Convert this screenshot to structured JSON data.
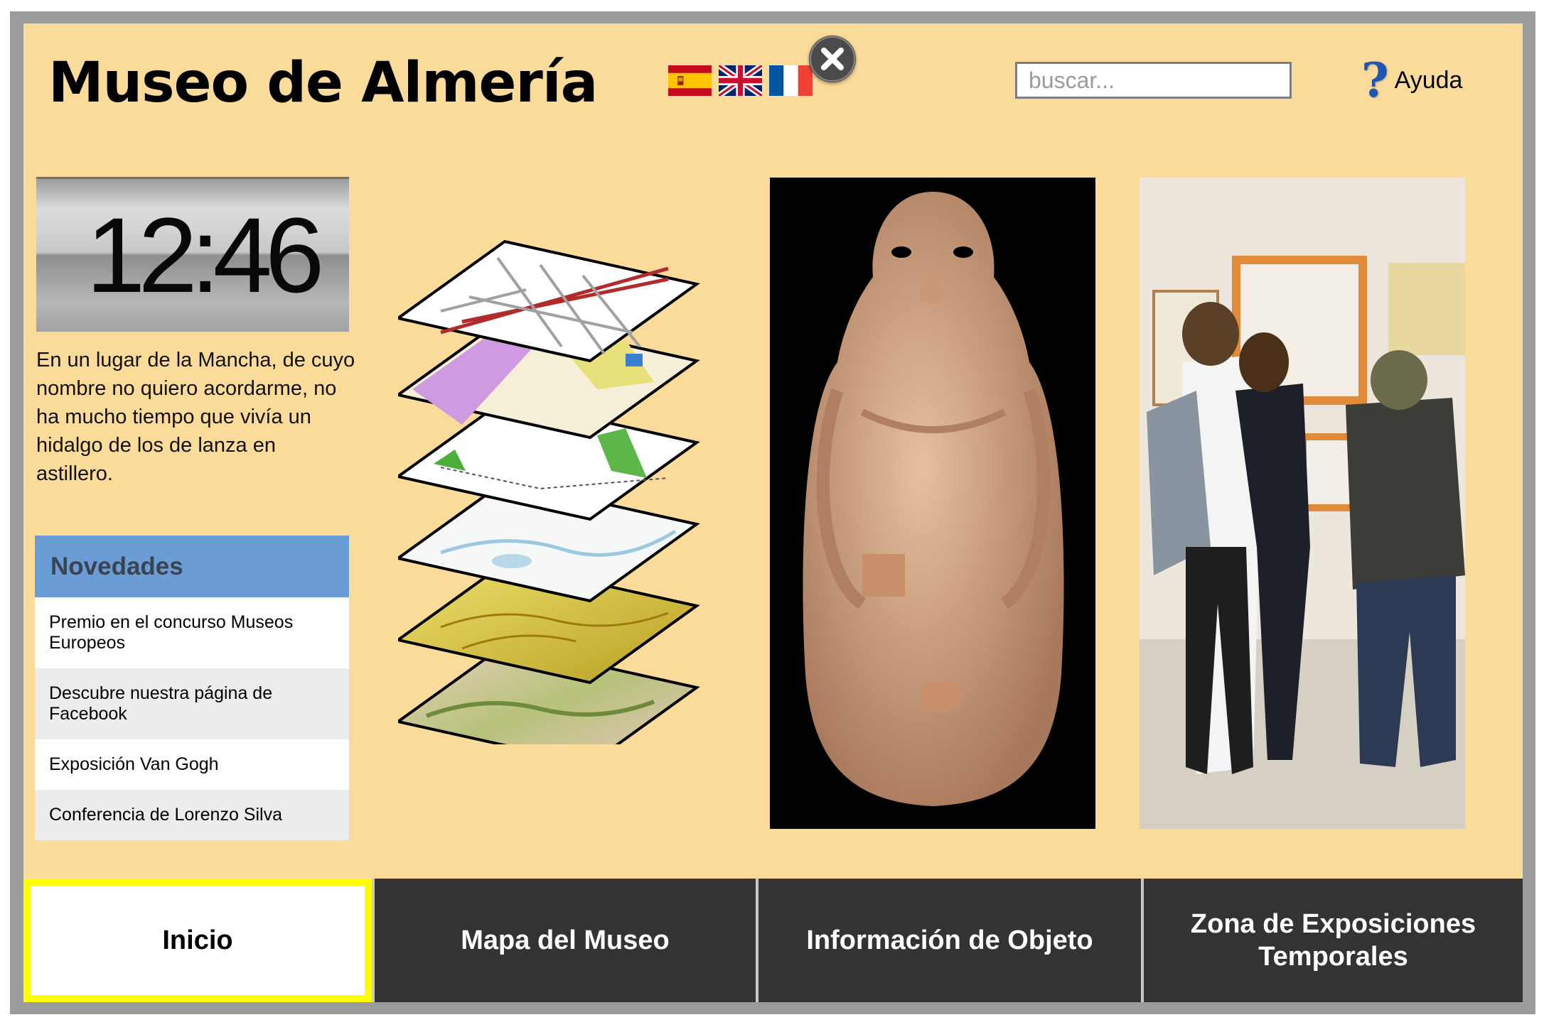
{
  "header": {
    "title": "Museo de Almería",
    "search_placeholder": "buscar...",
    "help_label": "Ayuda"
  },
  "languages": [
    {
      "name": "español",
      "icon": "spain-flag-icon"
    },
    {
      "name": "english",
      "icon": "uk-flag-icon"
    },
    {
      "name": "français",
      "icon": "france-flag-icon"
    }
  ],
  "icons": {
    "close": "close-icon",
    "help": "help-icon"
  },
  "clock": {
    "time": "12:46"
  },
  "intro_text": "En un lugar de la Mancha, de cuyo nombre no quiero acordarme, no ha mucho tiempo que vivía un hidalgo de los de lanza en astillero.",
  "news": {
    "title": "Novedades",
    "items": [
      "Premio en el concurso Museos Europeos",
      "Descubre nuestra página de Facebook",
      "Exposición Van Gogh",
      "Conferencia de Lorenzo Silva"
    ]
  },
  "tabs": [
    {
      "label": "Inicio",
      "active": true
    },
    {
      "label": "Mapa del Museo",
      "active": false
    },
    {
      "label": "Información de Objeto",
      "active": false
    },
    {
      "label": "Zona de Exposiciones Temporales",
      "active": false
    }
  ],
  "colors": {
    "background": "#fbdb9a",
    "news_header": "#6a9dd5",
    "tab_bar": "#333333",
    "active_tab_border": "#ffff00",
    "frame": "#9b9b9b"
  }
}
